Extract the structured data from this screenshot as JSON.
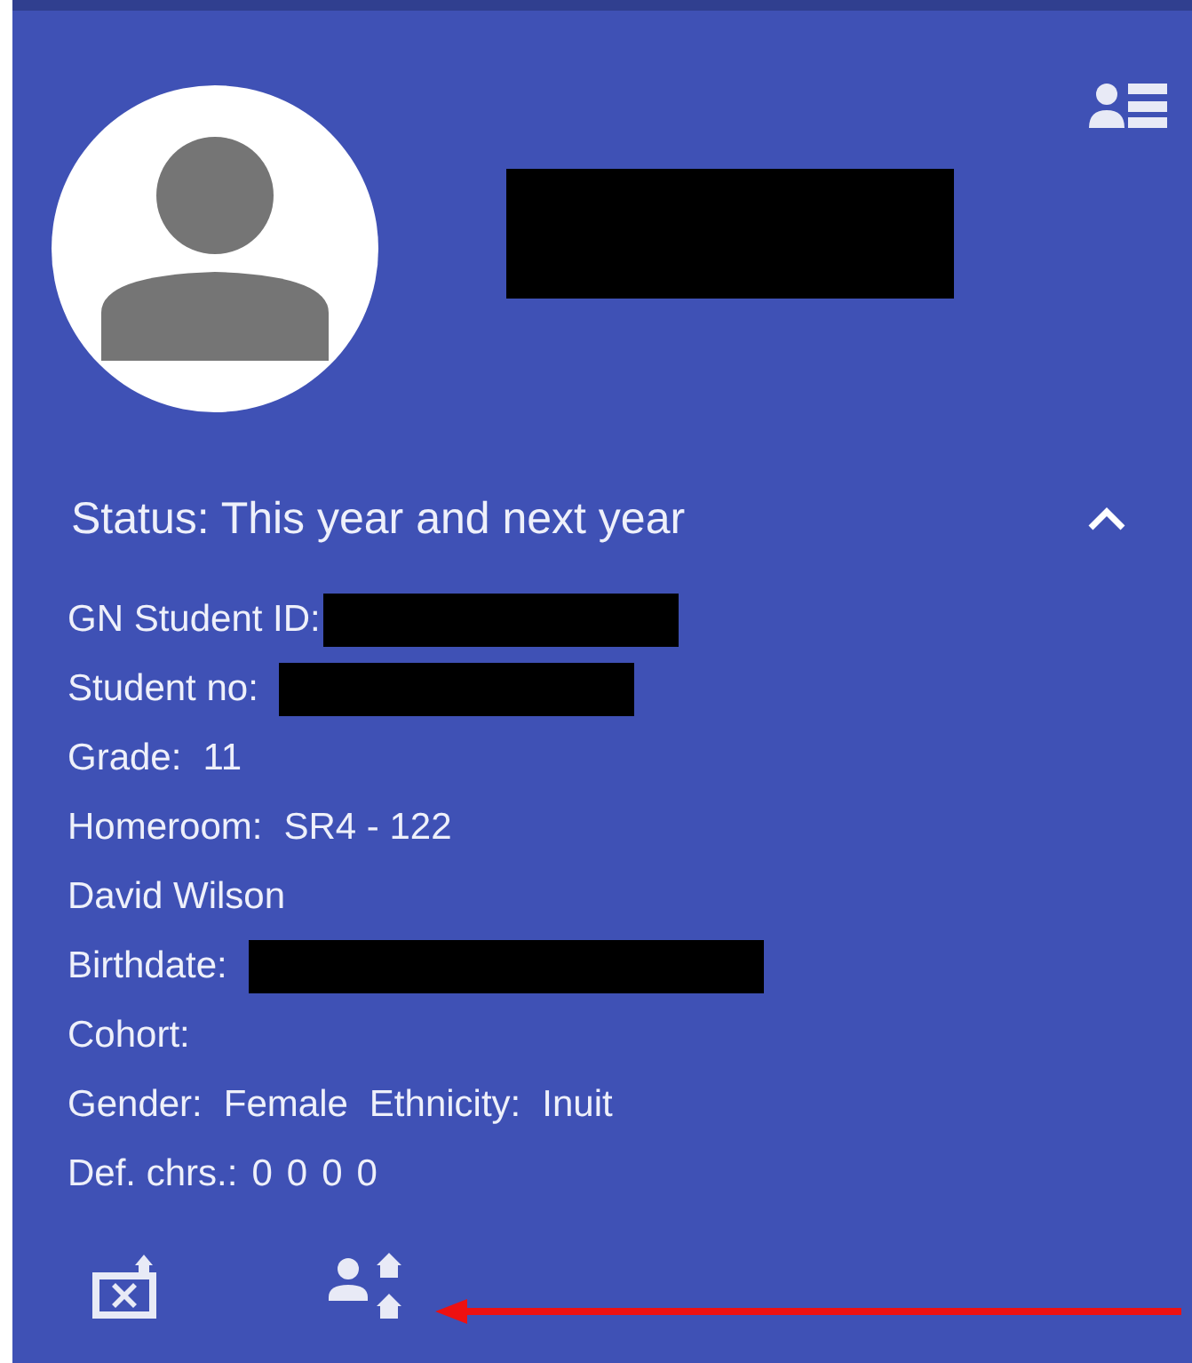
{
  "header": {
    "name_redacted": true
  },
  "status": {
    "text": "Status: This year and next year",
    "expanded": true
  },
  "rows": [
    {
      "texts": [
        "GN Student ID:"
      ],
      "redacted": true
    },
    {
      "texts": [
        "Student no:"
      ],
      "redacted": true
    },
    {
      "texts": [
        "Grade:",
        "11"
      ],
      "redacted": false
    },
    {
      "texts": [
        "Homeroom:",
        "SR4 - 122"
      ],
      "redacted": false
    },
    {
      "texts": [
        "David Wilson"
      ],
      "redacted": false
    },
    {
      "texts": [
        "Birthdate:"
      ],
      "redacted": true
    },
    {
      "texts": [
        "Cohort:"
      ],
      "redacted": false
    },
    {
      "texts": [
        "Gender:",
        "Female",
        "Ethnicity:",
        "Inuit"
      ],
      "redacted": false
    },
    {
      "texts": [
        "Def. chrs.:",
        "0",
        "0",
        "0",
        "0"
      ],
      "redacted": false
    }
  ],
  "annotation": {
    "kind": "arrow"
  }
}
